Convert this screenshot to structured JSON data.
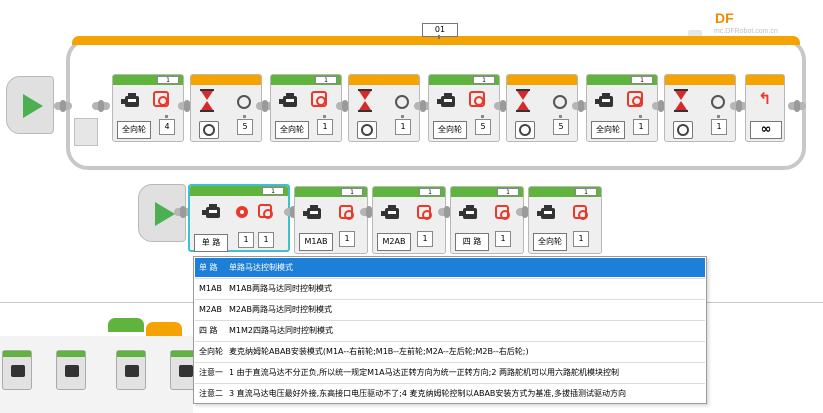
{
  "brand": {
    "logo": "DF",
    "site": "mc.DFRobot.com.cn"
  },
  "loop": {
    "count": "01"
  },
  "top_row": {
    "blocks": [
      {
        "kind": "motor",
        "port": "1",
        "mode": "全向轮",
        "value": "4"
      },
      {
        "kind": "wait",
        "value": "5"
      },
      {
        "kind": "motor",
        "port": "1",
        "mode": "全向轮",
        "value": "1"
      },
      {
        "kind": "wait",
        "value": "1"
      },
      {
        "kind": "motor",
        "port": "1",
        "mode": "全向轮",
        "value": "5"
      },
      {
        "kind": "wait",
        "value": "5"
      },
      {
        "kind": "motor",
        "port": "1",
        "mode": "全向轮",
        "value": "1"
      },
      {
        "kind": "wait",
        "value": "1"
      }
    ],
    "loop_end_symbol": "∞"
  },
  "bottom_row": {
    "blocks": [
      {
        "port": "1",
        "mode": "单 路",
        "value1": "1",
        "value2": "1"
      },
      {
        "port": "1",
        "mode": "M1AB",
        "value1": "1"
      },
      {
        "port": "1",
        "mode": "M2AB",
        "value1": "1"
      },
      {
        "port": "1",
        "mode": "四 路",
        "value1": "1"
      },
      {
        "port": "1",
        "mode": "全向轮",
        "value1": "1"
      }
    ]
  },
  "dropdown": {
    "items": [
      {
        "key": "单 路",
        "text": "单路马达控制模式",
        "selected": true
      },
      {
        "key": "M1AB",
        "text": "M1AB两路马达同时控制模式",
        "selected": false
      },
      {
        "key": "M2AB",
        "text": "M2AB两路马达同时控制模式",
        "selected": false
      },
      {
        "key": "四 路",
        "text": "M1M2四路马达同时控制模式",
        "selected": false
      },
      {
        "key": "全向轮",
        "text": "麦克纳姆轮ABAB安装模式(M1A--右前轮;M1B--左前轮;M2A--左后轮;M2B--右后轮;)",
        "selected": false
      },
      {
        "key": "注意一",
        "text": "1 由于直流马达不分正负,所以统一规定M1A马达正转方向为统一正转方向;2 两路舵机可以用六路舵机模块控制",
        "selected": false
      },
      {
        "key": "注意二",
        "text": "3 直流马达电压最好外接,东高接口电压驱动不了;4 麦克纳姆轮控制以ABAB安装方式为基准,多拔插测试驱动方向",
        "selected": false
      }
    ]
  },
  "colors": {
    "motor_bar": "#60b33d",
    "wait_bar": "#f5a300",
    "selection": "#40bfcf",
    "dropdown_highlight": "#1e7fd8",
    "start_play": "#4caf50"
  }
}
